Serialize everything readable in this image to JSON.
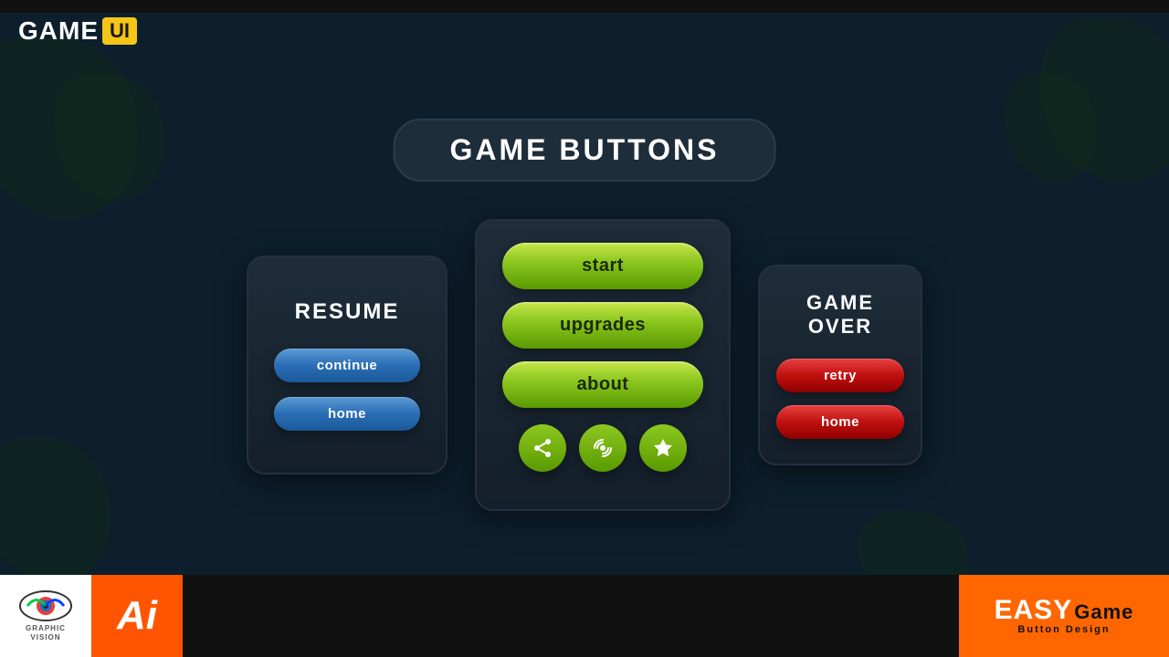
{
  "logo": {
    "game": "GAME",
    "ui": "UI"
  },
  "header": {
    "title": "GAME BUTTONS"
  },
  "resume_card": {
    "title": "RESUME",
    "continue_label": "continue",
    "home_label": "home"
  },
  "main_card": {
    "start_label": "start",
    "upgrades_label": "upgrades",
    "about_label": "about",
    "share_icon": "share",
    "radio_icon": "radio",
    "star_icon": "star"
  },
  "gameover_card": {
    "title": "GAME\nOVER",
    "retry_label": "retry",
    "home_label": "home"
  },
  "bottom": {
    "gv_text": "GRAPHIC\nVISION",
    "ai_text": "Ai",
    "easy": "EASY",
    "game": "Game",
    "sub": "Button Design"
  }
}
